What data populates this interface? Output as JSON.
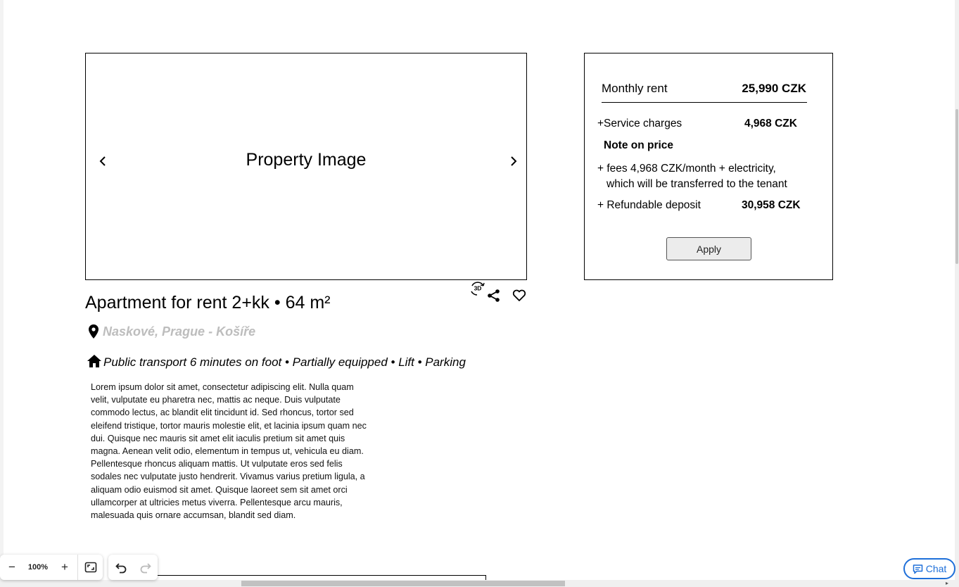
{
  "image": {
    "placeholder": "Property Image"
  },
  "icons": {
    "three_d": "3D",
    "prev": "chevron-left-icon",
    "next": "chevron-right-icon",
    "share": "share-icon",
    "favorite": "heart-icon",
    "location": "map-pin-icon",
    "home": "home-icon"
  },
  "listing": {
    "title": "Apartment for rent 2+kk • 64 m²",
    "location": "Naskové, Prague - Košíře",
    "features": "Public transport 6 minutes on foot • Partially equipped • Lift • Parking",
    "description": "Lorem ipsum dolor sit amet, consectetur adipiscing elit. Nulla quam velit, vulputate eu pharetra nec, mattis ac neque. Duis vulputate commodo lectus, ac blandit elit tincidunt id. Sed rhoncus, tortor sed eleifend tristique, tortor mauris molestie elit, et lacinia ipsum quam nec dui. Quisque nec mauris sit amet elit iaculis pretium sit amet quis magna. Aenean velit odio, elementum in tempus ut, vehicula eu diam. Pellentesque rhoncus aliquam mattis. Ut vulputate eros sed felis sodales nec vulputate justo hendrerit. Vivamus varius pretium ligula, a aliquam odio euismod sit amet. Quisque laoreet sem sit amet orci ullamcorper at ultricies metus viverra. Pellentesque arcu mauris, malesuada quis ornare accumsan, blandit sed diam."
  },
  "pricing": {
    "rent_label": "Monthly rent",
    "rent_value": "25,990 CZK",
    "service_label": "+Service charges",
    "service_value": "4,968 CZK",
    "note_title": "Note on price",
    "note_line1": "+ fees 4,968 CZK/month + electricity,",
    "note_line2": "which will be transferred to the tenant",
    "deposit_label": "+ Refundable deposit",
    "deposit_value": "30,958 CZK",
    "apply_label": "Apply"
  },
  "toolbar": {
    "zoom_out": "−",
    "zoom_level": "100%",
    "zoom_in": "+"
  },
  "chat": {
    "label": "Chat",
    "accent": "#1e6fd9"
  }
}
